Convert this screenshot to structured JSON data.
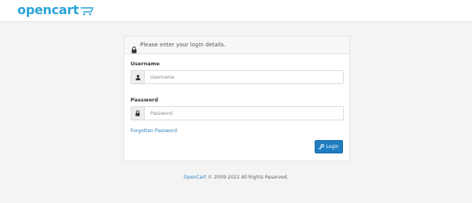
{
  "brand": {
    "name": "opencart",
    "color": "#2aa4d8"
  },
  "panel": {
    "title": "Please enter your login details.",
    "title_icon": "lock-icon"
  },
  "form": {
    "username_label": "Username",
    "username_placeholder": "Username",
    "username_icon": "user-icon",
    "password_label": "Password",
    "password_placeholder": "Password",
    "password_icon": "lock-icon",
    "forgotten_link": "Forgotten Password",
    "login_button": "Login",
    "login_icon": "key-icon",
    "button_color": "#1f7dc1"
  },
  "footer": {
    "link_text": "OpenCart",
    "rest": "© 2009-2022 All Rights Reserved."
  }
}
